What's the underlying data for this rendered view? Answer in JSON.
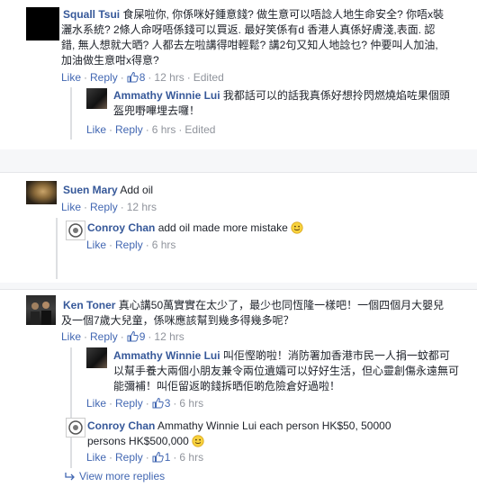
{
  "comments": [
    {
      "author": "Squall Tsui",
      "lines": [
        "食屎啦你, 你係咪好鍾意錢? 做生意可以唔諗人地生命安全? 你唔x裝",
        "灑水系統? 2條人命呀唔係錢可以買返. 最好笑係有d 香港人真係好膚淺,表面. 認",
        "錯, 無人想就大晒? 人都去左啦講得咁輕鬆? 講2句又知人地諗乜? 仲要叫人加油,",
        "加油做生意咁x得意?"
      ],
      "actions": {
        "like": "Like",
        "reply": "Reply",
        "likes": "8",
        "time": "12 hrs",
        "edited": "Edited"
      },
      "reply": {
        "author": "Ammathy Winnie Lui",
        "lines": [
          "我都話可以的話我真係好想拎閃燃燒焰咗果個頭",
          "盔兜嘢嗶埋去囉！"
        ],
        "actions": {
          "like": "Like",
          "reply": "Reply",
          "time": "6 hrs",
          "edited": "Edited"
        }
      }
    },
    {
      "author": "Suen Mary",
      "text": "Add oil",
      "actions": {
        "like": "Like",
        "reply": "Reply",
        "time": "12 hrs"
      },
      "reply": {
        "author": "Conroy Chan",
        "text": "add oil made more mistake",
        "actions": {
          "like": "Like",
          "reply": "Reply",
          "time": "6 hrs"
        }
      }
    },
    {
      "author": "Ken Toner",
      "lines": [
        "真心講50萬實實在太少了，最少也同恆隆一樣吧！一個四個月大嬰兒",
        "及一個7歲大兒童，係咪應該幫到幾多得幾多呢？"
      ],
      "actions": {
        "like": "Like",
        "reply": "Reply",
        "likes": "9",
        "time": "12 hrs"
      },
      "replies": [
        {
          "author": "Ammathy Winnie Lui",
          "lines": [
            "叫佢慳啲啦！消防署加香港市民一人捐一蚊都可",
            "以幫手養大兩個小朋友兼令兩位遺孀可以好好生活，但心靈創傷永遠無可",
            "能彌補！叫佢留返啲錢拆晒佢啲危險倉好過啦！"
          ],
          "actions": {
            "like": "Like",
            "reply": "Reply",
            "likes": "3",
            "time": "6 hrs"
          }
        },
        {
          "author": "Conroy Chan",
          "lines": [
            "Ammathy Winnie Lui each person HK$50, 50000",
            "persons HK$500,000"
          ],
          "actions": {
            "like": "Like",
            "reply": "Reply",
            "likes": "1",
            "time": "6 hrs"
          }
        }
      ]
    }
  ],
  "view_more": "View more replies",
  "colors": {
    "link": "#4267b2",
    "name": "#365899",
    "meta": "#90949c",
    "background": "#f6f7f9"
  }
}
